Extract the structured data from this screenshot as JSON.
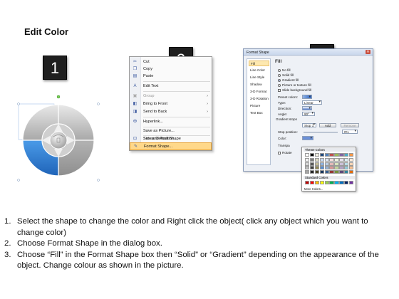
{
  "title": "Edit Color",
  "steps": [
    "1",
    "2",
    "3"
  ],
  "context_menu": {
    "items": [
      {
        "label": "Cut",
        "icon": "scissors-icon",
        "enabled": true
      },
      {
        "label": "Copy",
        "icon": "copy-icon",
        "enabled": true
      },
      {
        "label": "Paste",
        "icon": "paste-icon",
        "enabled": true
      },
      {
        "label": "Edit Text",
        "icon": "text-box-icon",
        "enabled": true
      },
      {
        "label": "Group",
        "icon": "group-icon",
        "enabled": false,
        "submenu": true
      },
      {
        "label": "Bring to Front",
        "icon": "bring-front-icon",
        "enabled": true,
        "submenu": true
      },
      {
        "label": "Send to Back",
        "icon": "send-back-icon",
        "enabled": true,
        "submenu": true
      },
      {
        "label": "Hyperlink...",
        "icon": "hyperlink-icon",
        "enabled": true
      },
      {
        "label": "Save as Picture...",
        "icon": "",
        "enabled": true
      },
      {
        "label": "Set as Default Shape",
        "icon": "",
        "enabled": true
      },
      {
        "label": "Size and Position...",
        "icon": "size-icon",
        "enabled": true
      },
      {
        "label": "Format Shape...",
        "icon": "format-shape-icon",
        "enabled": true,
        "highlighted": true
      }
    ]
  },
  "format_dialog": {
    "title": "Format Shape",
    "nav": [
      "Fill",
      "Line Color",
      "Line Style",
      "Shadow",
      "3-D Format",
      "3-D Rotation",
      "Picture",
      "Text Box"
    ],
    "section_title": "Fill",
    "fill_options": [
      "No fill",
      "Solid fill",
      "Gradient fill",
      "Picture or texture fill",
      "Slide background fill"
    ],
    "selected_fill": "Gradient fill",
    "labels": {
      "preset_colors": "Preset colors:",
      "type": "Type:",
      "type_value": "Linear",
      "direction": "Direction:",
      "angle": "Angle:",
      "angle_value": "90°",
      "gradient_stops": "Gradient stops",
      "stop_value": "Stop 1",
      "add_button": "Add",
      "remove_button": "Remove",
      "stop_position": "Stop position:",
      "stop_position_value": "0%",
      "color": "Color:",
      "transparency": "Transpa",
      "rotate": "Rotate"
    }
  },
  "palette": {
    "theme_title": "Theme Colors",
    "standard_title": "Standard Colors",
    "more": "More Colors...",
    "theme_top": [
      "#ffffff",
      "#000000",
      "#eeece1",
      "#1f497d",
      "#4f81bd",
      "#c0504d",
      "#9bbb59",
      "#8064a2",
      "#4bacc6",
      "#f79646"
    ],
    "theme_rows": [
      [
        "#f2f2f2",
        "#7f7f7f",
        "#ddd9c3",
        "#c6d9f0",
        "#dbe5f1",
        "#f2dcdb",
        "#ebf1dd",
        "#e5e0ec",
        "#dbeef3",
        "#fdeada"
      ],
      [
        "#d8d8d8",
        "#595959",
        "#c4bd97",
        "#8db3e2",
        "#b8cce4",
        "#e5b9b7",
        "#d7e3bc",
        "#ccc1d9",
        "#b7dde8",
        "#fbd5b5"
      ],
      [
        "#bfbfbf",
        "#3f3f3f",
        "#938953",
        "#548dd4",
        "#95b3d7",
        "#d99694",
        "#c3d69b",
        "#b2a2c7",
        "#92cddc",
        "#fac08f"
      ],
      [
        "#a5a5a5",
        "#262626",
        "#494429",
        "#17365d",
        "#366092",
        "#953734",
        "#76923c",
        "#5f497a",
        "#31859b",
        "#e36c09"
      ]
    ],
    "standard": [
      "#c00000",
      "#ff0000",
      "#ffc000",
      "#ffff00",
      "#92d050",
      "#00b050",
      "#00b0f0",
      "#0070c0",
      "#002060",
      "#7030a0"
    ]
  },
  "shape_colors": {
    "accent": "#2f7fd6",
    "ring_light": "#d9d9d9",
    "ring_dark": "#9a9a9a",
    "center": "#bfbfbf"
  },
  "instructions": [
    {
      "num": "1.",
      "text": "Select the shape to change the color and Right click the object( click any object which you want to change color)"
    },
    {
      "num": "2.",
      "text": "Choose Format Shape in the dialog box."
    },
    {
      "num": "3.",
      "text": "Choose “Fill” in the Format Shape box then “Solid” or “Gradient” depending on the appearance of the object. Change colour as shown in the picture."
    }
  ]
}
